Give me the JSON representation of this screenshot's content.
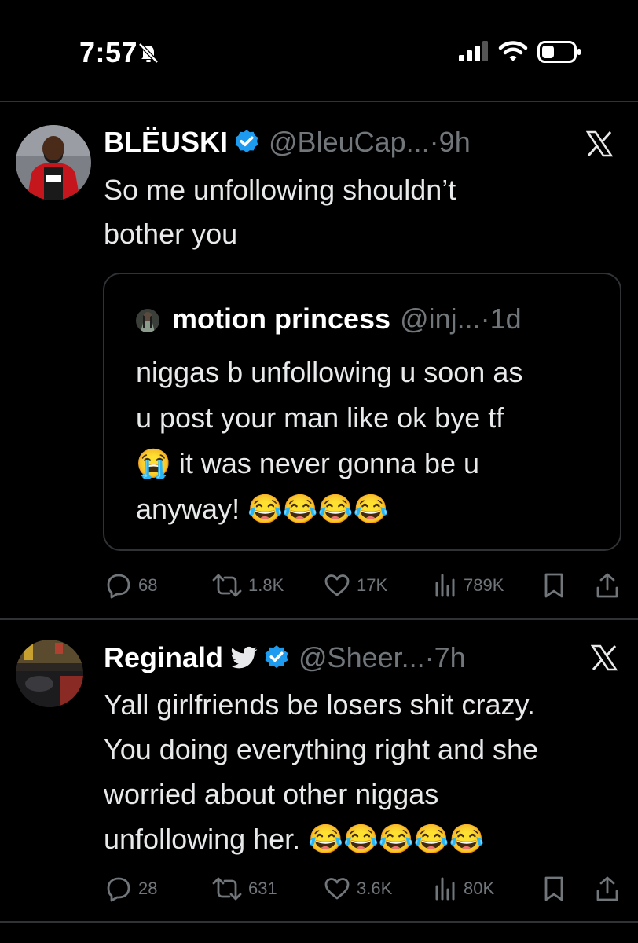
{
  "status_bar": {
    "time": "7:57"
  },
  "tweets": [
    {
      "display_name": "BLËUSKI",
      "handle": "@BleuCap...",
      "dot": "·",
      "time_ago": "9h",
      "text": "So me unfollowing shouldn’t\nbother you",
      "quote": {
        "display_name": "motion princess",
        "handle": "@inj...",
        "dot": "·",
        "time_ago": "1d",
        "text": "niggas b unfollowing u soon as\nu post your man like ok bye tf\n😭 it was never gonna be u\nanyway! 😂😂😂😂"
      },
      "stats": {
        "replies": "68",
        "reposts": "1.8K",
        "likes": "17K",
        "views": "789K"
      }
    },
    {
      "display_name": "Reginald",
      "handle": "@Sheer...",
      "dot": "·",
      "time_ago": "7h",
      "text": "Yall girlfriends be losers shit crazy.\nYou doing everything right and she\nworried about other niggas\nunfollowing her. 😂😂😂😂😂",
      "stats": {
        "replies": "28",
        "reposts": "631",
        "likes": "3.6K",
        "views": "80K"
      }
    }
  ],
  "colors": {
    "accent": "#1d9bf0",
    "muted": "#71767b",
    "text": "#e7e9ea",
    "divider": "#2f3336"
  }
}
